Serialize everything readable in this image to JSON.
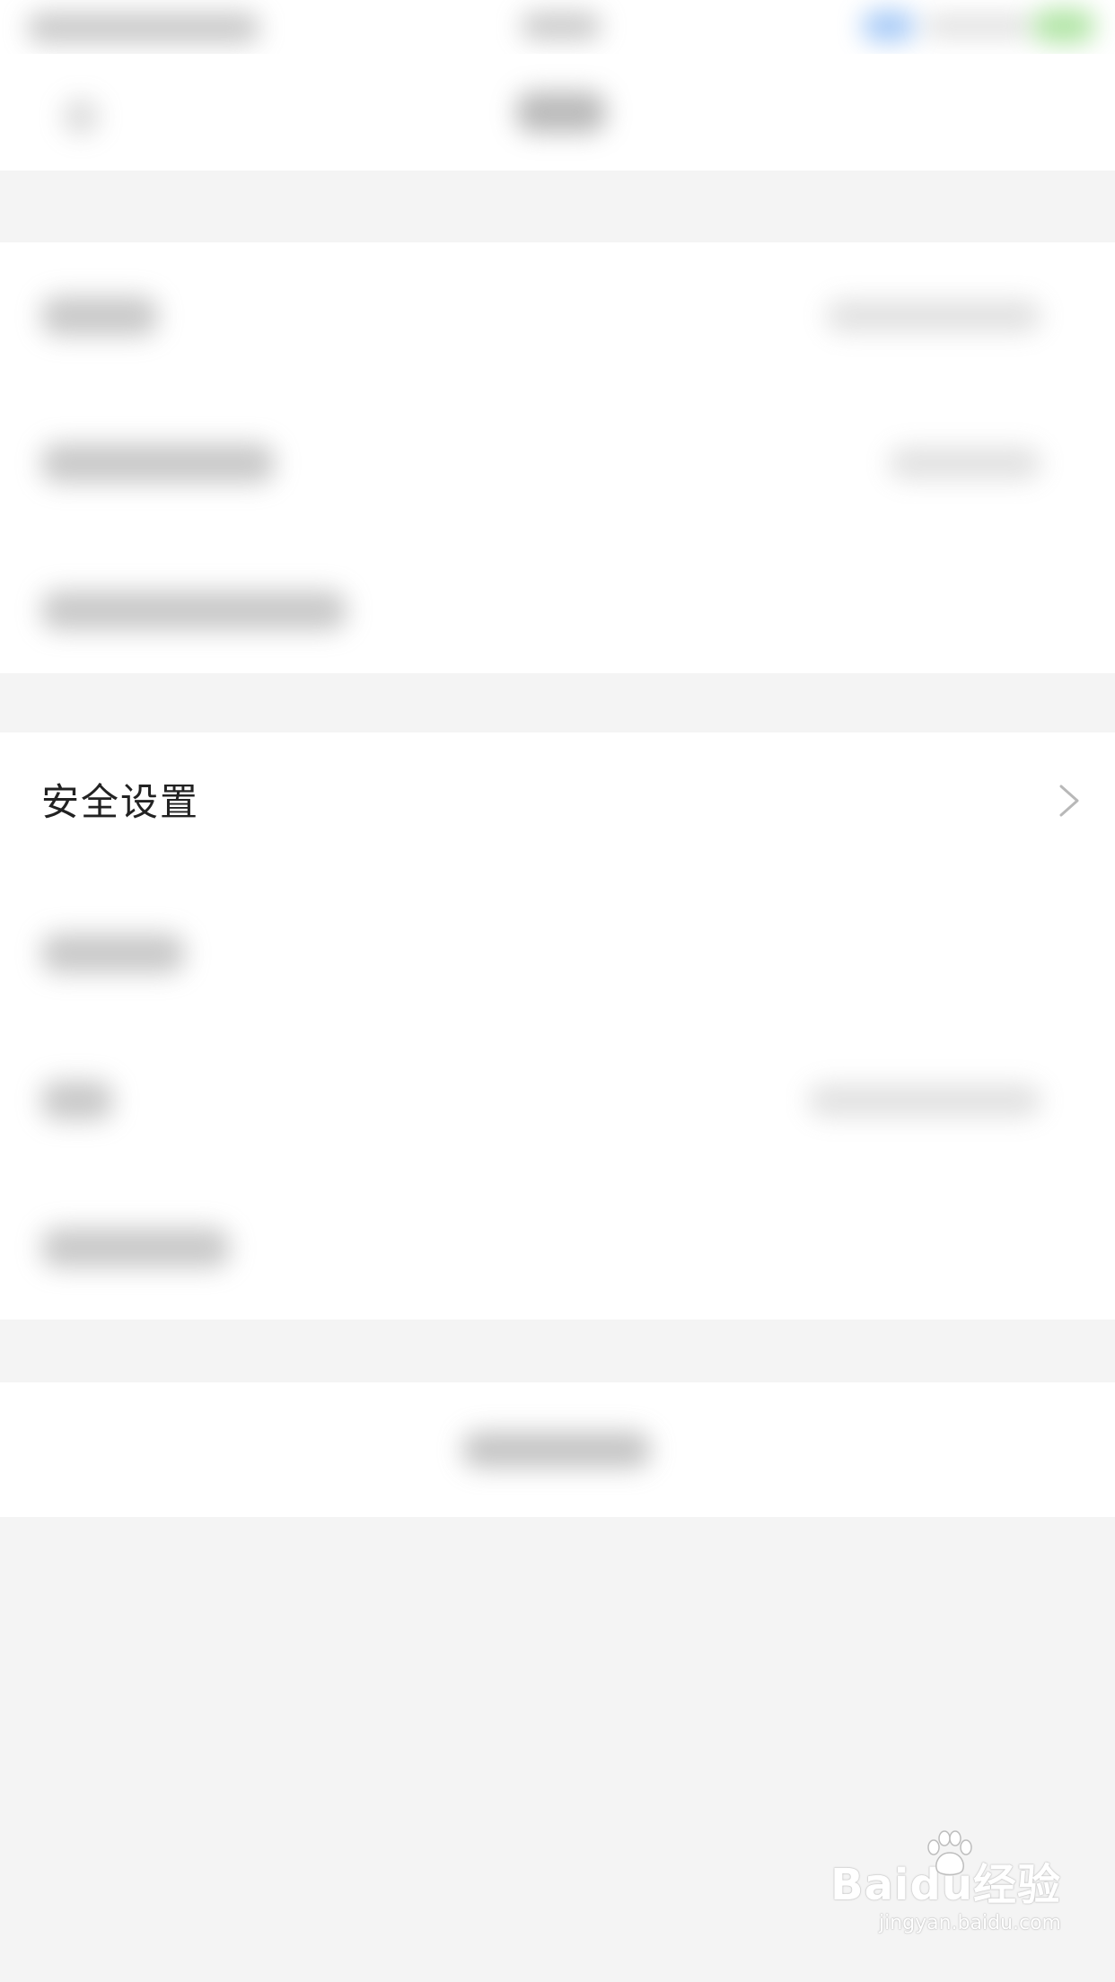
{
  "settings": {
    "focused_item_label": "安全设置"
  },
  "icons": {
    "chevron": "chevron-right-icon",
    "paw": "baidu-paw-icon"
  },
  "colors": {
    "background": "#f4f4f4",
    "surface": "#ffffff",
    "text_primary": "#222222",
    "chevron": "#b8b8b8"
  },
  "watermark": {
    "logo": "Baidu经验",
    "url": "jingyan.baidu.com"
  }
}
